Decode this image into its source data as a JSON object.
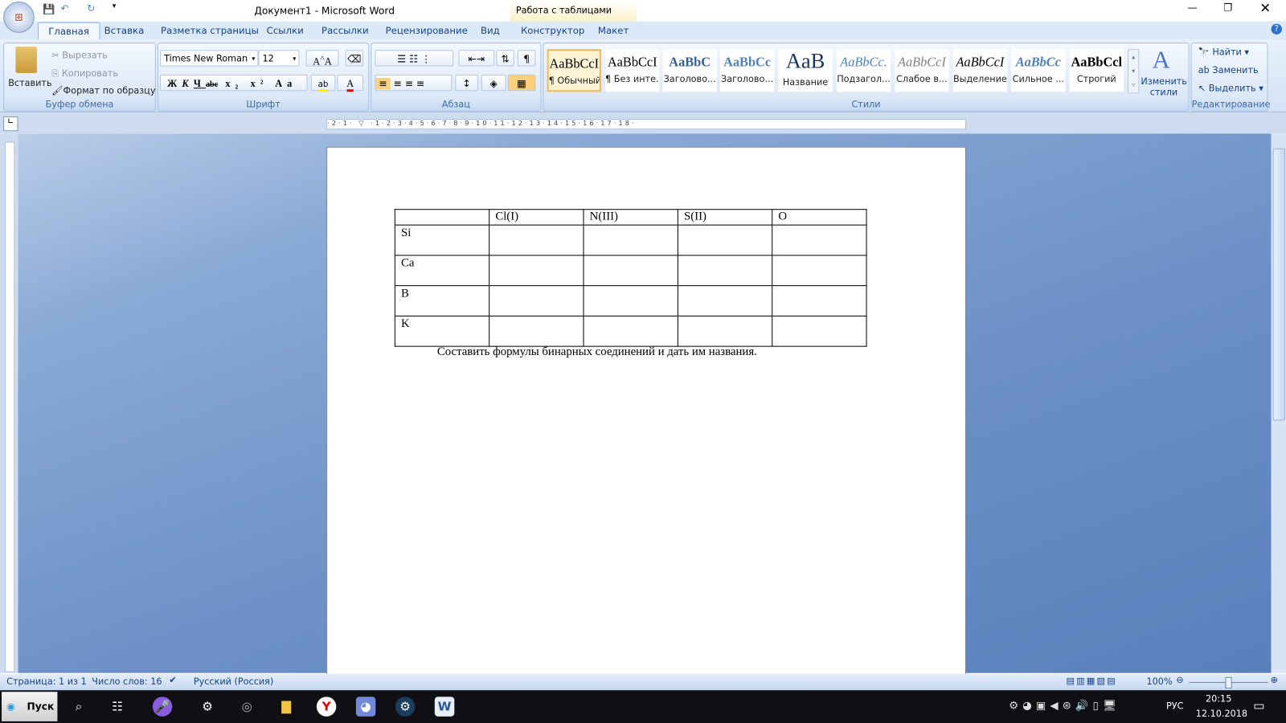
{
  "window": {
    "title": "Документ1 - Microsoft Word",
    "context_tab": "Работа с таблицами"
  },
  "tabs": [
    "Главная",
    "Вставка",
    "Разметка страницы",
    "Ссылки",
    "Рассылки",
    "Рецензирование",
    "Вид",
    "Конструктор",
    "Макет"
  ],
  "clipboard": {
    "paste": "Вставить",
    "cut": "Вырезать",
    "copy": "Копировать",
    "format_painter": "Формат по образцу",
    "label": "Буфер обмена"
  },
  "font": {
    "name": "Times New Roman",
    "size": "12",
    "label": "Шрифт",
    "bold": "Ж",
    "italic": "К",
    "underline": "Ч",
    "strike": "abc",
    "case": "Aa"
  },
  "paragraph": {
    "label": "Абзац",
    "pilcrow": "¶"
  },
  "styles": {
    "label": "Стили",
    "items": [
      {
        "sample": "AaBbCcI",
        "name": "¶ Обычный"
      },
      {
        "sample": "AaBbCcI",
        "name": "¶ Без инте..."
      },
      {
        "sample": "AaBbC",
        "name": "Заголово..."
      },
      {
        "sample": "AaBbCc",
        "name": "Заголово..."
      },
      {
        "sample": "AaB",
        "name": "Название"
      },
      {
        "sample": "AaBbCc.",
        "name": "Подзагол..."
      },
      {
        "sample": "AaBbCcI",
        "name": "Слабое в..."
      },
      {
        "sample": "AaBbCcI",
        "name": "Выделение"
      },
      {
        "sample": "AaBbCc",
        "name": "Сильное ..."
      },
      {
        "sample": "AaBbCcl",
        "name": "Строгий"
      }
    ],
    "change_styles": "Изменить стили"
  },
  "editing": {
    "label": "Редактирование",
    "find": "Найти",
    "replace": "Заменить",
    "select": "Выделить"
  },
  "document": {
    "table": {
      "header": [
        "",
        "Cl(I)",
        "N(III)",
        "S(II)",
        "O"
      ],
      "rows": [
        [
          "Si",
          "",
          "",
          "",
          ""
        ],
        [
          "Ca",
          "",
          "",
          "",
          ""
        ],
        [
          "B",
          "",
          "",
          "",
          ""
        ],
        [
          "K",
          "",
          "",
          "",
          ""
        ]
      ]
    },
    "caption": "Составить формулы бинарных соединений и дать им названия."
  },
  "status": {
    "page": "Страница: 1 из 1",
    "words": "Число слов: 16",
    "language": "Русский (Россия)",
    "zoom": "100%"
  },
  "taskbar": {
    "start": "Пуск",
    "lang": "РУС",
    "time": "20:15",
    "date": "12.10.2018"
  },
  "colors": {
    "ribbon": "#dce9f8",
    "workspace": "#6b8fc6",
    "taskbar": "#0f0f14"
  }
}
